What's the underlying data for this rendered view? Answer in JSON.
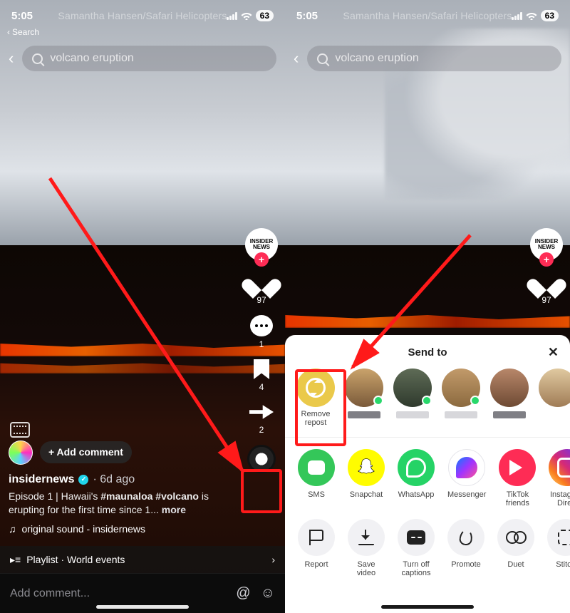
{
  "status": {
    "time": "5:05",
    "battery": "63"
  },
  "credit": "Samantha Hansen/Safari Helicopters",
  "back_search": "Search",
  "search": {
    "query": "volcano eruption"
  },
  "rail": {
    "avatar": "INSIDER NEWS",
    "likes": "97",
    "comments": "1",
    "saves": "4",
    "shares": "2"
  },
  "post": {
    "add_comment": "+ Add comment",
    "username": "insidernews",
    "time": "6d ago",
    "caption_a": "Episode 1 | Hawaii's ",
    "caption_b": "#maunaloa #volcano",
    "caption_c": " is erupting for the first time since 1...",
    "more": " more",
    "sound": "original sound - insidernews",
    "playlist": "Playlist · World events"
  },
  "comment_input": {
    "placeholder": "Add comment..."
  },
  "sheet": {
    "title": "Send to",
    "remove_repost": "Remove repost",
    "apps": {
      "sms": "SMS",
      "snapchat": "Snapchat",
      "whatsapp": "WhatsApp",
      "messenger": "Messenger",
      "tiktok_friends": "TikTok friends",
      "instagram": "Instagram Direct"
    },
    "actions": {
      "report": "Report",
      "save": "Save video",
      "captions": "Turn off captions",
      "promote": "Promote",
      "duet": "Duet",
      "stitch": "Stitch"
    }
  }
}
